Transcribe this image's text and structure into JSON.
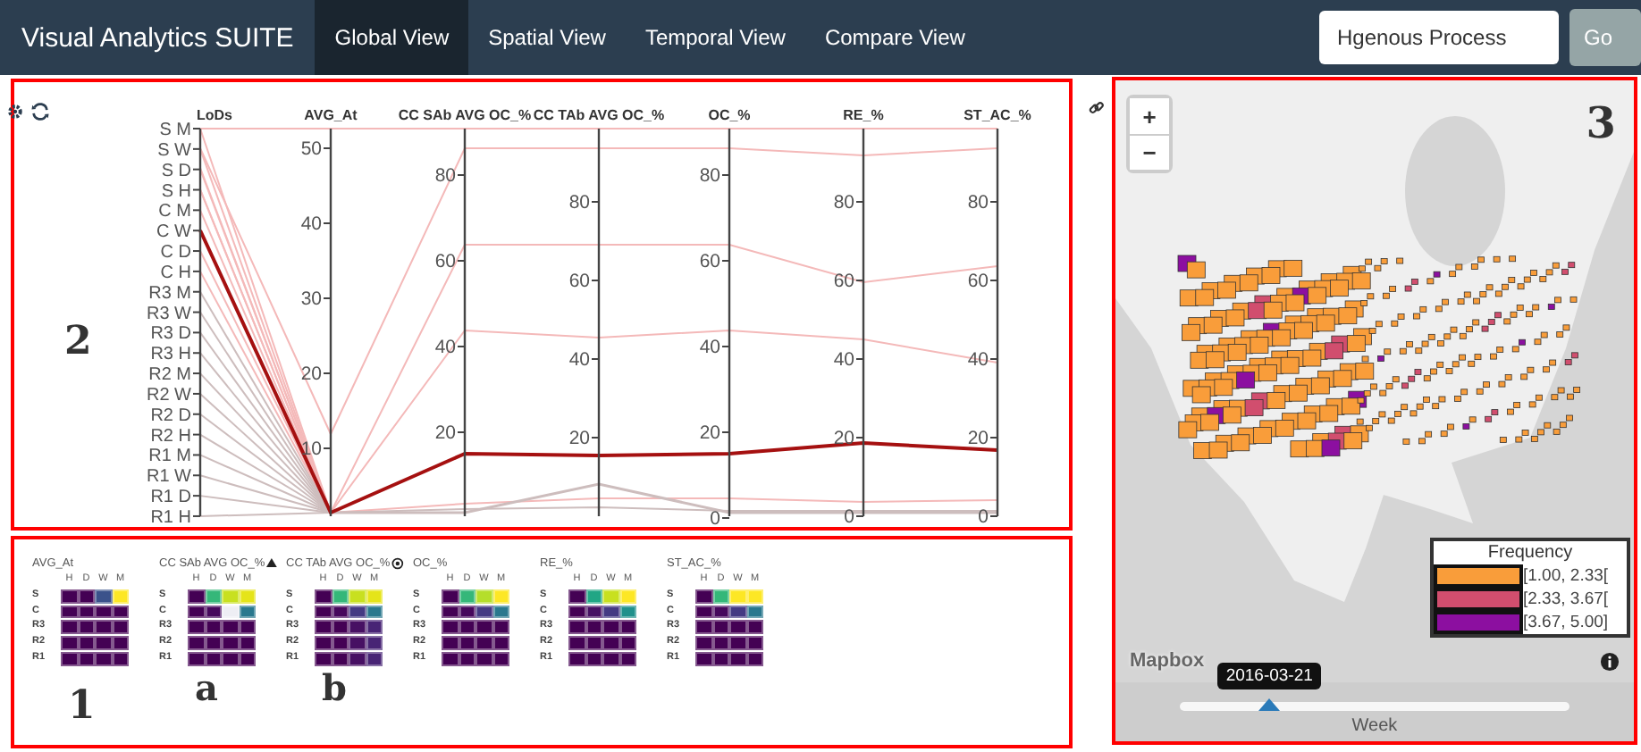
{
  "navbar": {
    "brand": "Visual Analytics SUITE",
    "tabs": [
      {
        "label": "Global View",
        "selected": true
      },
      {
        "label": "Spatial View",
        "selected": false
      },
      {
        "label": "Temporal View",
        "selected": false
      },
      {
        "label": "Compare View",
        "selected": false
      }
    ],
    "search": {
      "value": "Hgenous Process"
    },
    "go_button": "Go"
  },
  "parallel_coordinates": {
    "marker": "2",
    "axes": [
      {
        "label": "LoDs",
        "kind": "categorical",
        "ticks": [
          "S M",
          "S W",
          "S D",
          "S H",
          "C M",
          "C W",
          "C D",
          "C H",
          "R3 M",
          "R3 W",
          "R3 D",
          "R3 H",
          "R2 M",
          "R2 W",
          "R2 D",
          "R2 H",
          "R1 M",
          "R1 W",
          "R1 D",
          "R1 H"
        ]
      },
      {
        "label": "AVG_At",
        "kind": "numeric",
        "ticks": [
          "50",
          "40",
          "30",
          "20",
          "10"
        ]
      },
      {
        "label": "CC SAb AVG OC_%",
        "kind": "numeric",
        "ticks": [
          "80",
          "60",
          "40",
          "20"
        ]
      },
      {
        "label": "CC TAb AVG OC_%",
        "kind": "numeric",
        "ticks": [
          "80",
          "60",
          "40",
          "20"
        ]
      },
      {
        "label": "OC_%",
        "kind": "numeric",
        "ticks": [
          "80",
          "60",
          "40",
          "20",
          "0"
        ]
      },
      {
        "label": "RE_%",
        "kind": "numeric",
        "ticks": [
          "80",
          "60",
          "40",
          "20",
          "0"
        ]
      },
      {
        "label": "ST_AC_%",
        "kind": "numeric",
        "ticks": [
          "80",
          "60",
          "40",
          "20",
          "0"
        ]
      }
    ]
  },
  "heatmaps": {
    "marker": "1",
    "items": [
      {
        "title": "AVG_At",
        "kind": "plain",
        "columns": [
          "H",
          "D",
          "W",
          "M"
        ],
        "rows": [
          {
            "label": "S",
            "cells": [
              {
                "color": "#440154"
              },
              {
                "color": "#440154"
              },
              {
                "color": "#3b528b"
              },
              {
                "color": "#fde725"
              }
            ]
          },
          {
            "label": "C",
            "cells": [
              {
                "color": "#440154"
              },
              {
                "color": "#440154"
              },
              {
                "color": "#440154"
              },
              {
                "color": "#440154"
              }
            ]
          },
          {
            "label": "R3",
            "cells": [
              {
                "color": "#440154"
              },
              {
                "color": "#440154"
              },
              {
                "color": "#440154"
              },
              {
                "color": "#440154"
              }
            ]
          },
          {
            "label": "R2",
            "cells": [
              {
                "color": "#440154"
              },
              {
                "color": "#440154"
              },
              {
                "color": "#440154"
              },
              {
                "color": "#440154"
              }
            ]
          },
          {
            "label": "R1",
            "cells": [
              {
                "color": "#440154"
              },
              {
                "color": "#440154"
              },
              {
                "color": "#440154"
              },
              {
                "color": "#440154"
              }
            ]
          }
        ]
      },
      {
        "title": "CC SAb AVG OC_%",
        "kind": "triangle",
        "annotation": "a",
        "columns": [
          "H",
          "D",
          "W",
          "M"
        ],
        "rows": [
          {
            "label": "S",
            "cells": [
              {
                "color": "#440154"
              },
              {
                "color": "#35b779"
              },
              {
                "color": "#c8e020"
              },
              {
                "color": "#e5e419"
              }
            ]
          },
          {
            "label": "C",
            "cells": [
              {
                "color": "#440154"
              },
              {
                "color": "#46085c"
              },
              {
                "color": "#eeeef4"
              },
              {
                "color": "#2a788e"
              }
            ]
          },
          {
            "label": "R3",
            "cells": [
              {
                "color": "#440154"
              },
              {
                "color": "#440154"
              },
              {
                "color": "#440154"
              },
              {
                "color": "#440154"
              }
            ]
          },
          {
            "label": "R2",
            "cells": [
              {
                "color": "#440154"
              },
              {
                "color": "#440154"
              },
              {
                "color": "#440154"
              },
              {
                "color": "#440154"
              }
            ]
          },
          {
            "label": "R1",
            "cells": [
              {
                "color": "#440154"
              },
              {
                "color": "#440154"
              },
              {
                "color": "#440154"
              },
              {
                "color": "#440154"
              }
            ]
          }
        ]
      },
      {
        "title": "CC TAb AVG OC_%",
        "kind": "target",
        "annotation": "b",
        "columns": [
          "H",
          "D",
          "W",
          "M"
        ],
        "rows": [
          {
            "label": "S",
            "cells": [
              {
                "color": "#440154"
              },
              {
                "color": "#35b779"
              },
              {
                "color": "#c8e020"
              },
              {
                "color": "#e5e419"
              }
            ]
          },
          {
            "label": "C",
            "cells": [
              {
                "color": "#440154"
              },
              {
                "color": "#46085c"
              },
              {
                "color": "#443a83"
              },
              {
                "color": "#2a788e"
              }
            ]
          },
          {
            "label": "R3",
            "cells": [
              {
                "color": "#440154"
              },
              {
                "color": "#440154"
              },
              {
                "color": "#471063"
              },
              {
                "color": "#482475"
              }
            ]
          },
          {
            "label": "R2",
            "cells": [
              {
                "color": "#440154"
              },
              {
                "color": "#440154"
              },
              {
                "color": "#471063"
              },
              {
                "color": "#482475"
              }
            ]
          },
          {
            "label": "R1",
            "cells": [
              {
                "color": "#440154"
              },
              {
                "color": "#440154"
              },
              {
                "color": "#471063"
              },
              {
                "color": "#482475"
              }
            ]
          }
        ]
      },
      {
        "title": "OC_%",
        "kind": "plain",
        "columns": [
          "H",
          "D",
          "W",
          "M"
        ],
        "rows": [
          {
            "label": "S",
            "cells": [
              {
                "color": "#440154"
              },
              {
                "color": "#35b779"
              },
              {
                "color": "#b5de2b"
              },
              {
                "color": "#fde725"
              }
            ]
          },
          {
            "label": "C",
            "cells": [
              {
                "color": "#440154"
              },
              {
                "color": "#46085c"
              },
              {
                "color": "#443a83"
              },
              {
                "color": "#2a788e"
              }
            ]
          },
          {
            "label": "R3",
            "cells": [
              {
                "color": "#440154"
              },
              {
                "color": "#440154"
              },
              {
                "color": "#440154"
              },
              {
                "color": "#440154"
              }
            ]
          },
          {
            "label": "R2",
            "cells": [
              {
                "color": "#440154"
              },
              {
                "color": "#440154"
              },
              {
                "color": "#440154"
              },
              {
                "color": "#440154"
              }
            ]
          },
          {
            "label": "R1",
            "cells": [
              {
                "color": "#440154"
              },
              {
                "color": "#440154"
              },
              {
                "color": "#440154"
              },
              {
                "color": "#440154"
              }
            ]
          }
        ]
      },
      {
        "title": "RE_%",
        "kind": "plain",
        "columns": [
          "H",
          "D",
          "W",
          "M"
        ],
        "rows": [
          {
            "label": "S",
            "cells": [
              {
                "color": "#440154"
              },
              {
                "color": "#21a685"
              },
              {
                "color": "#c8e020"
              },
              {
                "color": "#fde725"
              }
            ]
          },
          {
            "label": "C",
            "cells": [
              {
                "color": "#440154"
              },
              {
                "color": "#471063"
              },
              {
                "color": "#443a83"
              },
              {
                "color": "#21918c"
              }
            ]
          },
          {
            "label": "R3",
            "cells": [
              {
                "color": "#440154"
              },
              {
                "color": "#440154"
              },
              {
                "color": "#440154"
              },
              {
                "color": "#440154"
              }
            ]
          },
          {
            "label": "R2",
            "cells": [
              {
                "color": "#440154"
              },
              {
                "color": "#440154"
              },
              {
                "color": "#440154"
              },
              {
                "color": "#440154"
              }
            ]
          },
          {
            "label": "R1",
            "cells": [
              {
                "color": "#440154"
              },
              {
                "color": "#440154"
              },
              {
                "color": "#440154"
              },
              {
                "color": "#440154"
              }
            ]
          }
        ]
      },
      {
        "title": "ST_AC_%",
        "kind": "plain",
        "columns": [
          "H",
          "D",
          "W",
          "M"
        ],
        "rows": [
          {
            "label": "S",
            "cells": [
              {
                "color": "#440154"
              },
              {
                "color": "#35b779"
              },
              {
                "color": "#fde725"
              },
              {
                "color": "#fde725"
              }
            ]
          },
          {
            "label": "C",
            "cells": [
              {
                "color": "#440154"
              },
              {
                "color": "#46085c"
              },
              {
                "color": "#443a83"
              },
              {
                "color": "#2a788e"
              }
            ]
          },
          {
            "label": "R3",
            "cells": [
              {
                "color": "#440154"
              },
              {
                "color": "#440154"
              },
              {
                "color": "#440154"
              },
              {
                "color": "#440154"
              }
            ]
          },
          {
            "label": "R2",
            "cells": [
              {
                "color": "#440154"
              },
              {
                "color": "#440154"
              },
              {
                "color": "#440154"
              },
              {
                "color": "#440154"
              }
            ]
          },
          {
            "label": "R1",
            "cells": [
              {
                "color": "#440154"
              },
              {
                "color": "#440154"
              },
              {
                "color": "#440154"
              },
              {
                "color": "#440154"
              }
            ]
          }
        ]
      }
    ]
  },
  "map": {
    "marker": "3",
    "zoom_in": "+",
    "zoom_out": "−",
    "attribution": "Mapbox",
    "legend": {
      "title": "Frequency",
      "entries": [
        {
          "label": "[1.00, 2.33[",
          "color": "#f99d3a"
        },
        {
          "label": "[2.33, 3.67[",
          "color": "#d14e6e"
        },
        {
          "label": "[3.67, 5.00]",
          "color": "#8c0fa0"
        }
      ]
    },
    "slider": {
      "tooltip": "2016-03-21",
      "level": 0.23,
      "label": "Week"
    }
  }
}
